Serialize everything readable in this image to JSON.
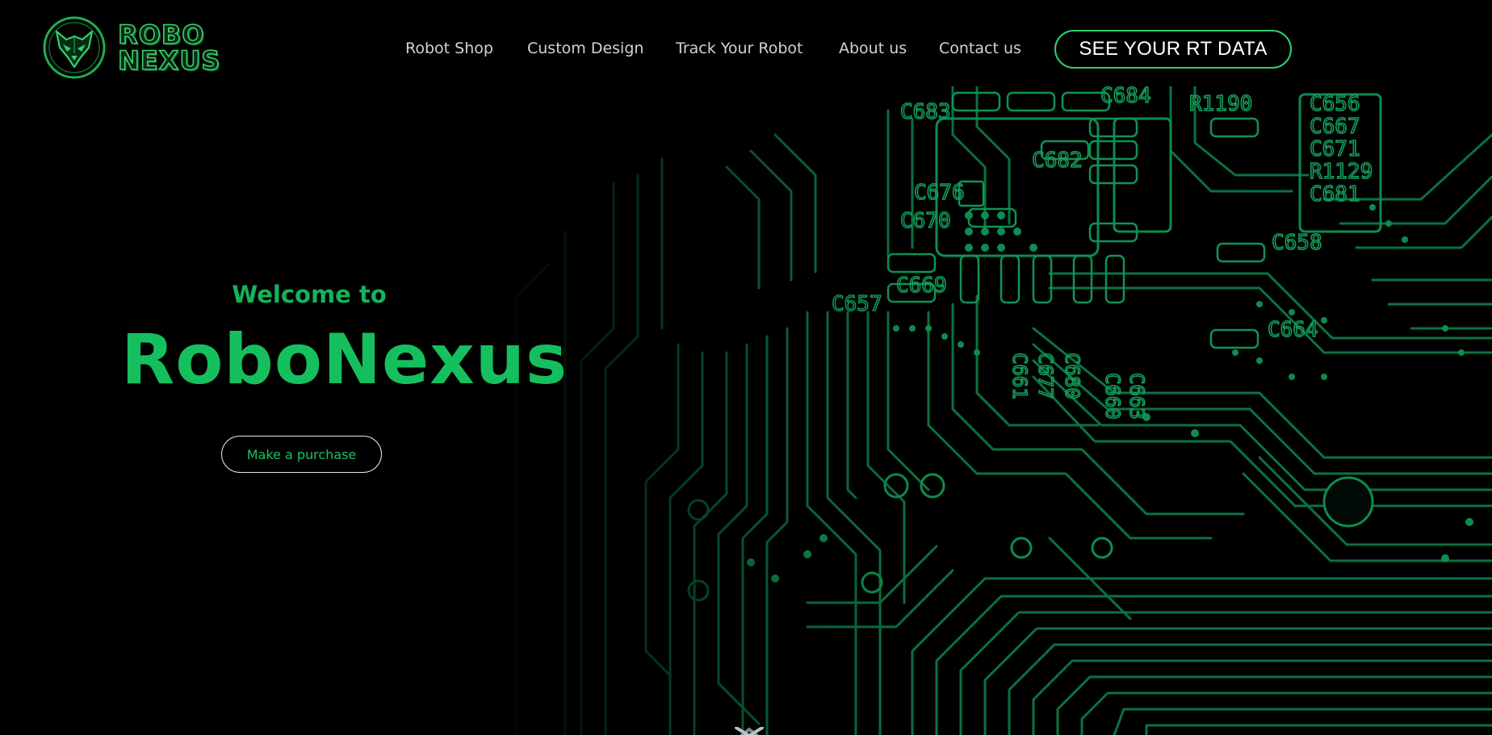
{
  "header": {
    "logo": {
      "line1": "ROBO",
      "line2": "NEXUS"
    },
    "nav": [
      {
        "label": "Robot Shop"
      },
      {
        "label": "Custom Design"
      },
      {
        "label": "Track Your Robot"
      },
      {
        "label": "About us"
      },
      {
        "label": "Contact us"
      }
    ],
    "cta_label": "SEE YOUR RT DATA"
  },
  "hero": {
    "welcome": "Welcome to",
    "brand": "RoboNexus",
    "purchase_label": "Make a purchase",
    "background": "circuit-board-image",
    "scroll_icon": "chevron-down-icon"
  },
  "pcb_labels": [
    "C683",
    "C684",
    "R1190",
    "C656",
    "C667",
    "C671",
    "R1129",
    "C681",
    "C682",
    "C676",
    "C670",
    "C669",
    "C657",
    "C658",
    "C664",
    "C661",
    "C677",
    "C680",
    "C660",
    "C663"
  ],
  "colors": {
    "background": "#000000",
    "accent": "#16bf5e",
    "cta_border": "#2bd16d",
    "nav_text": "#cfd3d6",
    "circuit": "#0b7a45"
  }
}
